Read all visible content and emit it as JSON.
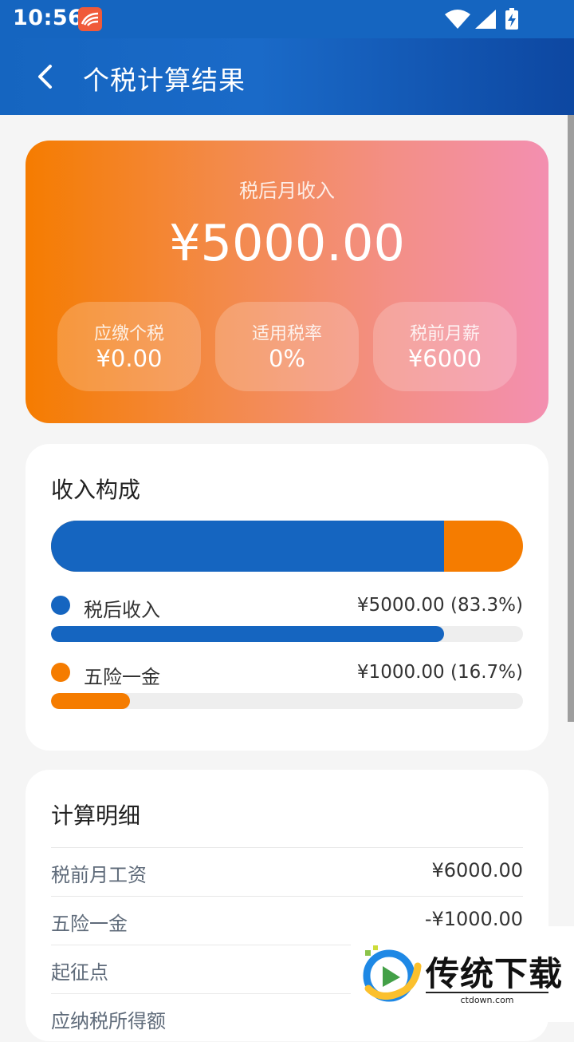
{
  "status": {
    "time": "10:56"
  },
  "appbar": {
    "title": "个税计算结果"
  },
  "hero": {
    "label": "税后月收入",
    "amount": "¥5000.00",
    "pills": [
      {
        "label": "应缴个税",
        "value": "¥0.00"
      },
      {
        "label": "适用税率",
        "value": "0%"
      },
      {
        "label": "税前月薪",
        "value": "¥6000"
      }
    ]
  },
  "composition": {
    "title": "收入构成",
    "items": [
      {
        "name": "税后收入",
        "value": "¥5000.00 (83.3%)",
        "fraction": 0.833,
        "color": "#1565c0"
      },
      {
        "name": "五险一金",
        "value": "¥1000.00 (16.7%)",
        "fraction": 0.167,
        "color": "#f57c00"
      }
    ]
  },
  "details": {
    "title": "计算明细",
    "rows": [
      {
        "label": "税前月工资",
        "value": "¥6000.00"
      },
      {
        "label": "五险一金",
        "value": "-¥1000.00"
      },
      {
        "label": "起征点",
        "value": ""
      },
      {
        "label": "应纳税所得额",
        "value": ""
      }
    ]
  },
  "watermark": {
    "brand": "传统下载",
    "site": "ctdown.com"
  },
  "colors": {
    "primary": "#1565c0",
    "accent": "#f57c00",
    "gradient_end": "#f38fb0"
  }
}
